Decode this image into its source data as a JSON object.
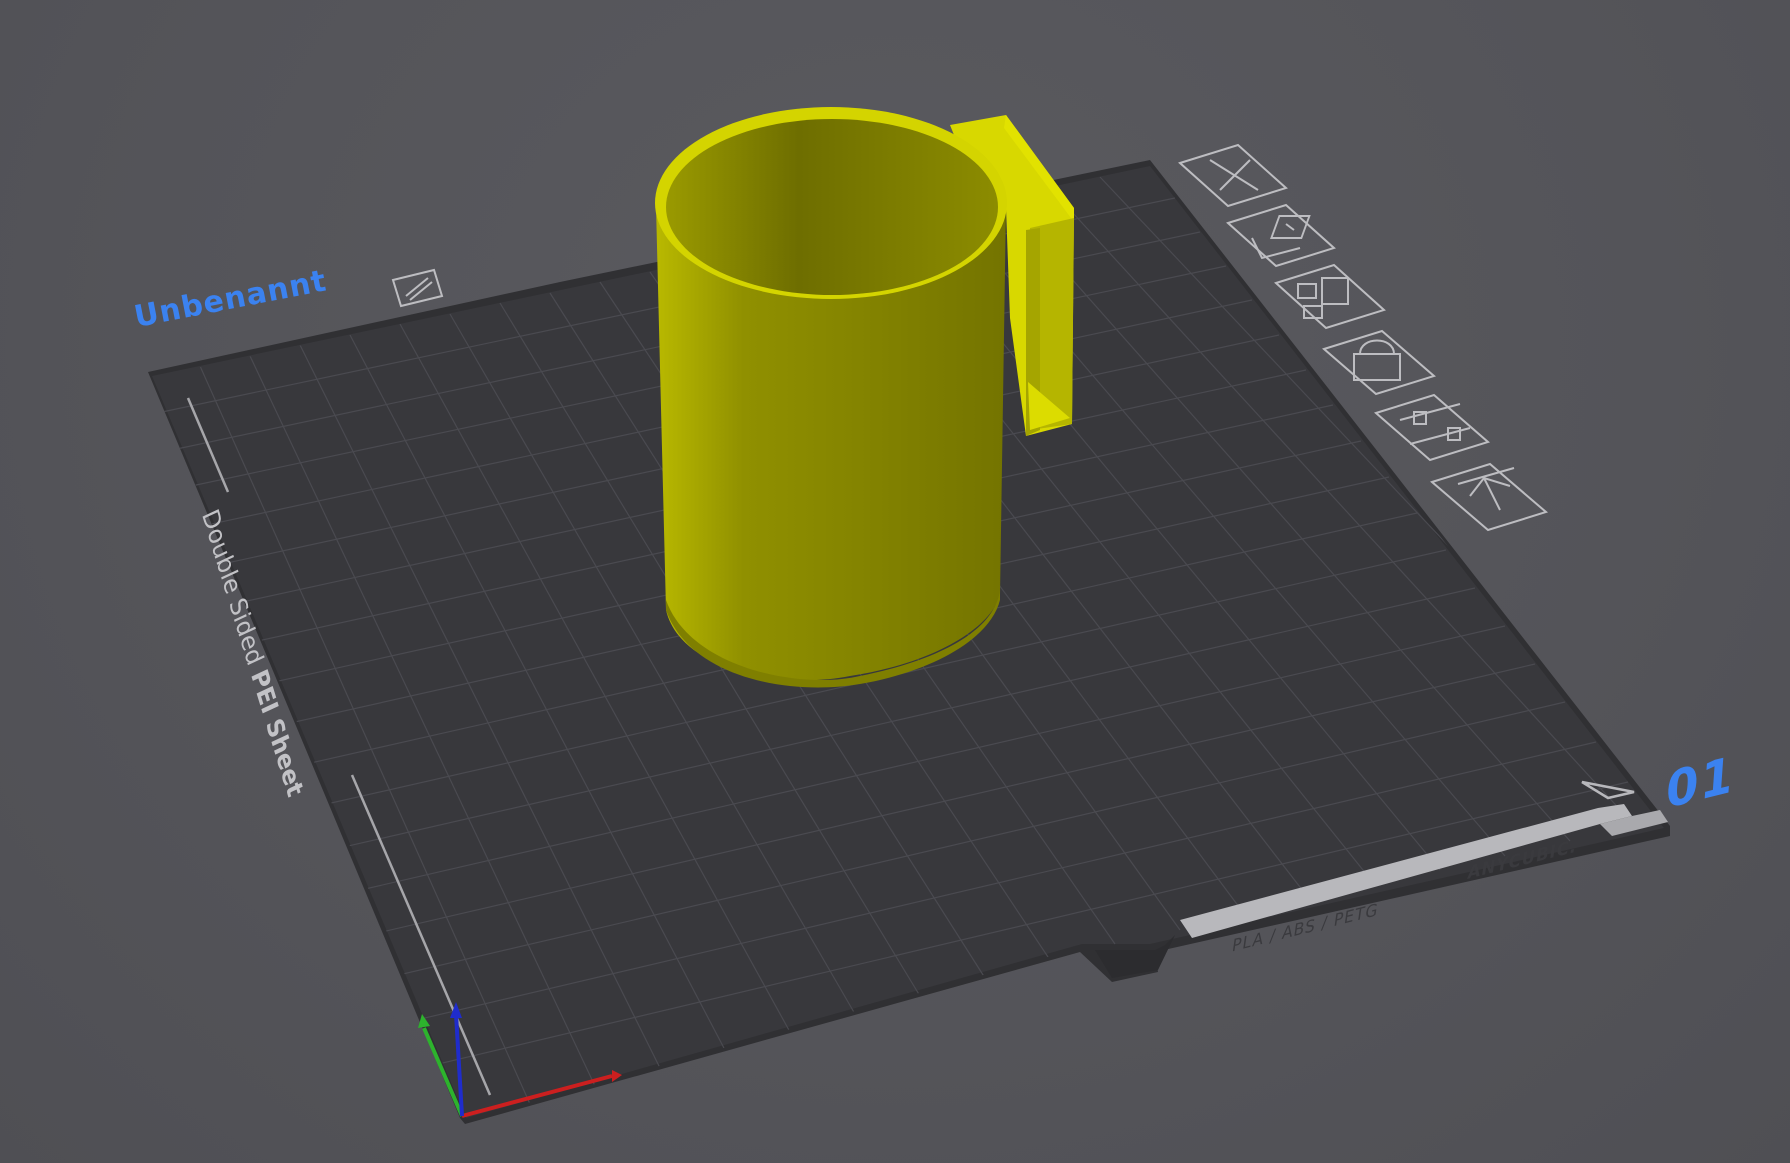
{
  "plate": {
    "name": "Unbenannt",
    "number": "01",
    "sheet_label_prefix": "Double Sided ",
    "sheet_label_bold": "PEI Sheet",
    "materials": "PLA / ABS / PETG",
    "brand": "ANYCUBIC."
  },
  "toolbar": {
    "buttons": [
      {
        "name": "delete-plate-button",
        "icon": "close-icon"
      },
      {
        "name": "auto-orient-button",
        "icon": "orient-icon"
      },
      {
        "name": "arrange-button",
        "icon": "arrange-icon"
      },
      {
        "name": "lock-plate-button",
        "icon": "lock-icon"
      },
      {
        "name": "plate-settings-button",
        "icon": "sliders-icon"
      },
      {
        "name": "move-to-top-button",
        "icon": "arrow-up-icon"
      }
    ]
  },
  "colors": {
    "background": "#545459",
    "bed": "#38383c",
    "grid": "#4c4c52",
    "model": "#c9c900",
    "accent": "#3b82f0",
    "axis_x": "#cc1f1f",
    "axis_y": "#2db32d",
    "axis_z": "#1f2ccc"
  }
}
